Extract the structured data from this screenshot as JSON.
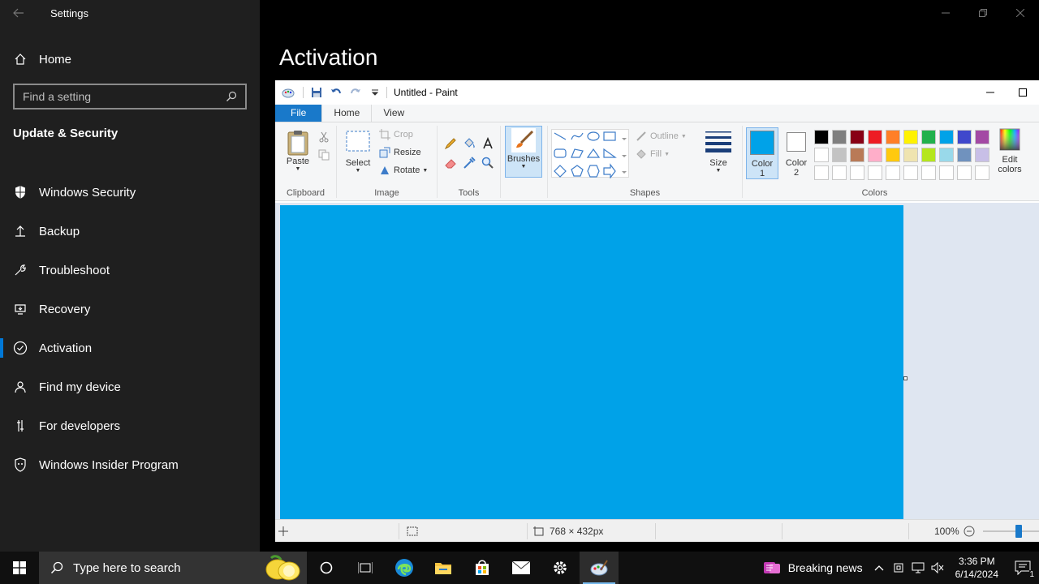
{
  "settings": {
    "app_title": "Settings",
    "home_label": "Home",
    "search_placeholder": "Find a setting",
    "section_title": "Update & Security",
    "nav_items": [
      {
        "label": "Windows Security",
        "icon": "shield-icon"
      },
      {
        "label": "Backup",
        "icon": "backup-icon"
      },
      {
        "label": "Troubleshoot",
        "icon": "wrench-icon"
      },
      {
        "label": "Recovery",
        "icon": "recovery-icon"
      },
      {
        "label": "Activation",
        "icon": "check-circle-icon",
        "active": true
      },
      {
        "label": "Find my device",
        "icon": "person-pin-icon"
      },
      {
        "label": "For developers",
        "icon": "developer-icon"
      },
      {
        "label": "Windows Insider Program",
        "icon": "insider-icon"
      }
    ],
    "page_title": "Activation"
  },
  "paint": {
    "window_title": "Untitled - Paint",
    "tabs": {
      "file": "File",
      "home": "Home",
      "view": "View"
    },
    "groups": {
      "clipboard": "Clipboard",
      "image": "Image",
      "tools": "Tools",
      "shapes": "Shapes",
      "colors": "Colors"
    },
    "buttons": {
      "paste": "Paste",
      "select": "Select",
      "crop": "Crop",
      "resize": "Resize",
      "rotate": "Rotate",
      "brushes": "Brushes",
      "outline": "Outline",
      "fill": "Fill",
      "size": "Size",
      "color1_line1": "Color",
      "color1_line2": "1",
      "color2_line1": "Color",
      "color2_line2": "2",
      "edit_colors_line1": "Edit",
      "edit_colors_line2": "colors"
    },
    "color1": "#00a2e8",
    "color2": "#ffffff",
    "palette_row1": [
      "#000000",
      "#7f7f7f",
      "#880015",
      "#ed1c24",
      "#ff7f27",
      "#fff200",
      "#22b14c",
      "#00a2e8",
      "#3f48cc",
      "#a349a4"
    ],
    "palette_row2": [
      "#ffffff",
      "#c3c3c3",
      "#b97a57",
      "#ffaec9",
      "#ffc90e",
      "#efe4b0",
      "#b5e61d",
      "#99d9ea",
      "#7092be",
      "#c8bfe7"
    ],
    "canvas_color": "#00a2e8",
    "status": {
      "canvas_size": "768 × 432px",
      "zoom": "100%"
    }
  },
  "taskbar": {
    "search_placeholder": "Type here to search",
    "news": "Breaking news",
    "time": "3:36 PM",
    "date": "6/14/2024",
    "notification_count": "1"
  }
}
